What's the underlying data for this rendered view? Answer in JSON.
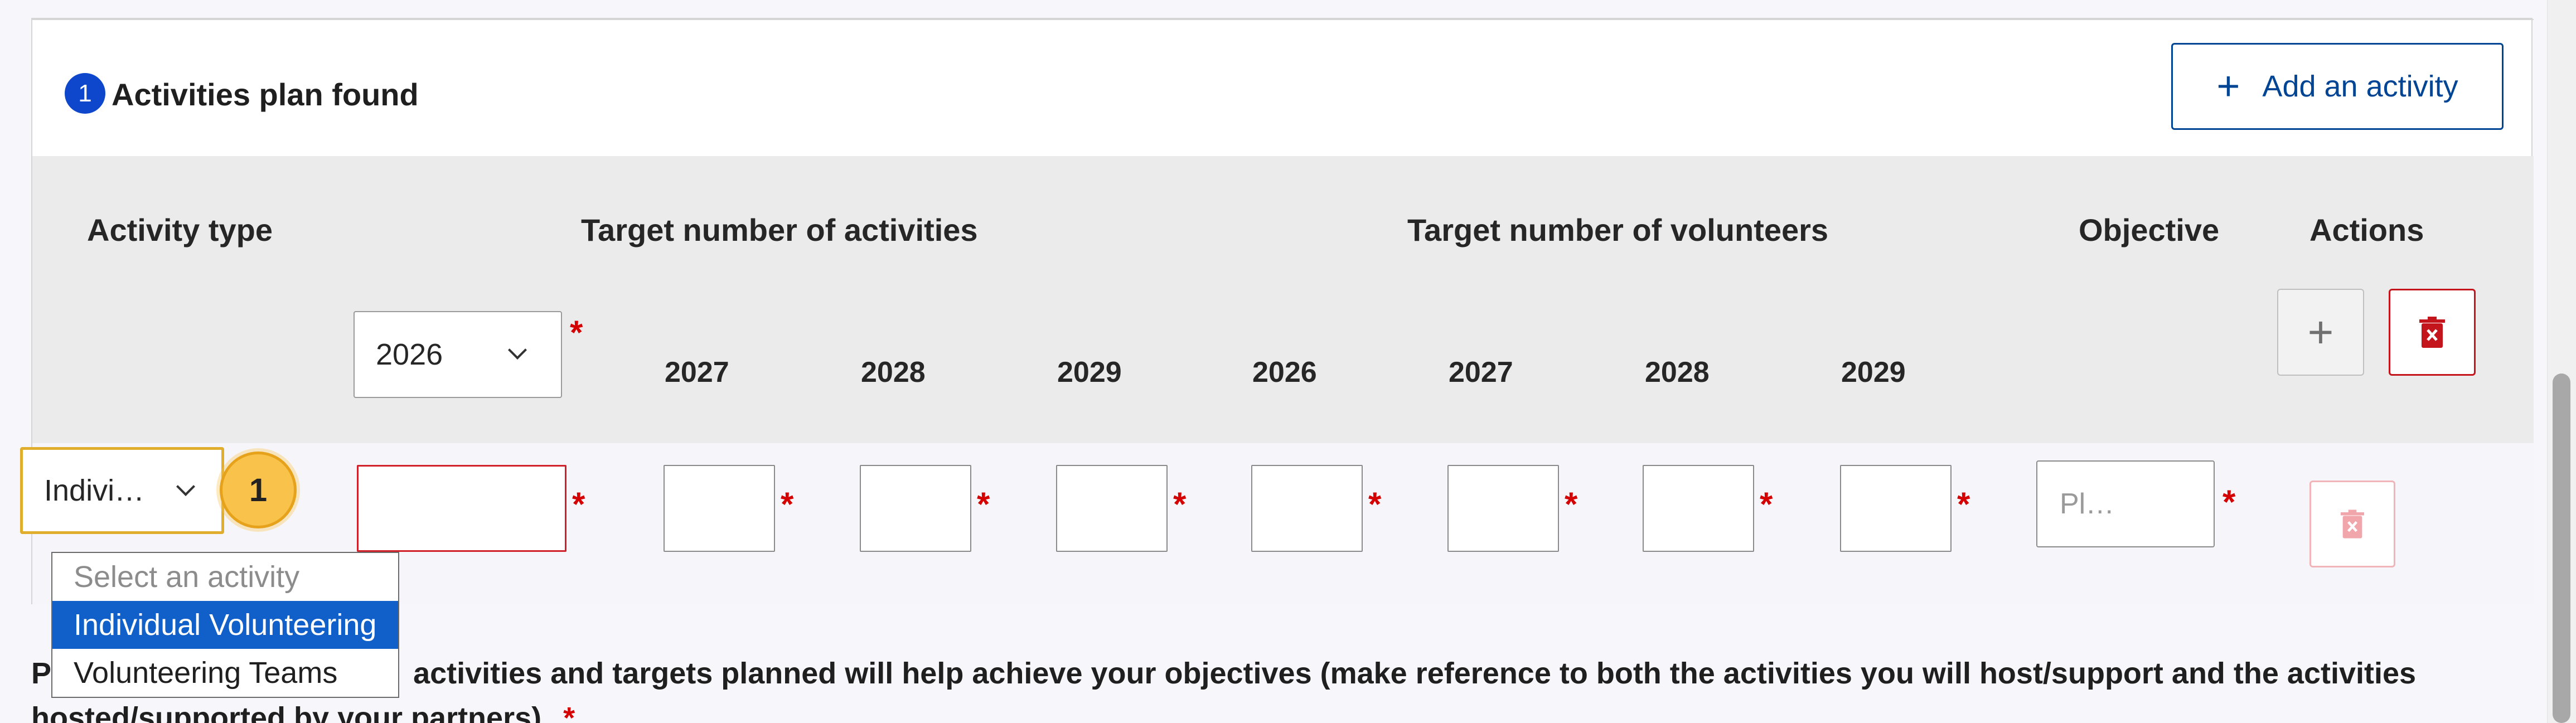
{
  "header": {
    "count": "1",
    "title": "Activities plan found",
    "add_button_label": "Add an activity"
  },
  "table": {
    "col_activity_type": "Activity type",
    "col_target_activities": "Target number of activities",
    "col_target_volunteers": "Target number of volunteers",
    "col_objective": "Objective",
    "col_actions": "Actions",
    "start_year_selected": "2026",
    "activity_years": [
      "2027",
      "2028",
      "2029"
    ],
    "volunteer_years": [
      "2026",
      "2027",
      "2028",
      "2029"
    ],
    "required_mark": "*",
    "add_row_icon": "plus-icon",
    "delete_row_icon": "trash-icon"
  },
  "row": {
    "activity_type_value": "Indivi…",
    "objective_placeholder": "Pl…",
    "step_marker": "1"
  },
  "dropdown": {
    "options": [
      "Select an activity",
      "Individual Volunteering",
      "Volunteering Teams"
    ],
    "selected": "Individual Volunteering"
  },
  "paragraph": {
    "text_visible": "P                        activities and targets planned will help achieve your objectives (make reference to both the activities you will host/support and the activities hosted/supported by your partners)",
    "line1": "P",
    "line1_rest": "activities and targets planned will help achieve your objectives (make reference to both the activities you will host/support and the activities",
    "line2": "hosted/supported by your partners)",
    "required": "*"
  },
  "colors": {
    "primary": "#004494",
    "badge": "#0e47cb",
    "danger": "#c4141c",
    "required": "#d50000",
    "highlight": "#e0ad2c",
    "selected_option": "#1160c9"
  }
}
